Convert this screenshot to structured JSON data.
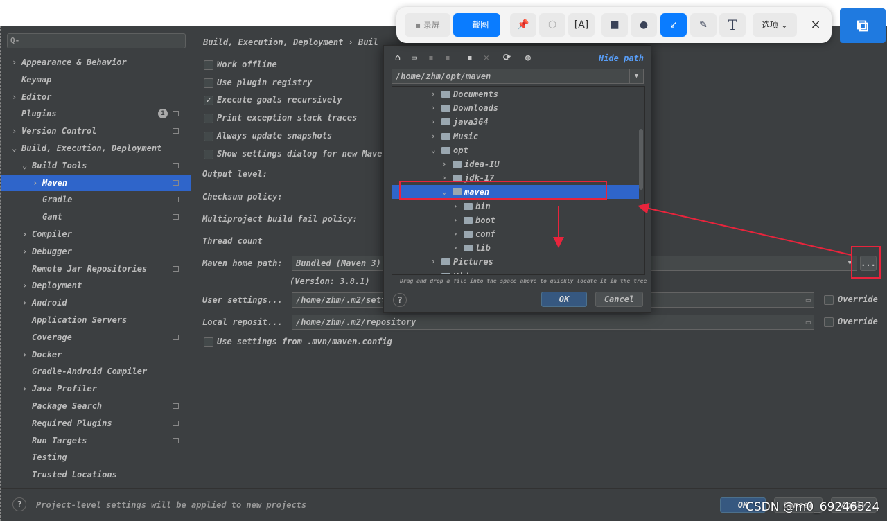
{
  "sidebar": {
    "search_placeholder": "Q-",
    "items": [
      {
        "label": "Appearance & Behavior",
        "expander": "›"
      },
      {
        "label": "Keymap"
      },
      {
        "label": "Editor",
        "expander": "›"
      },
      {
        "label": "Plugins",
        "badge": "1"
      },
      {
        "label": "Version Control",
        "expander": "›"
      },
      {
        "label": "Build, Execution, Deployment",
        "expander": "⌄"
      },
      {
        "label": "Build Tools",
        "expander": "⌄"
      },
      {
        "label": "Maven",
        "expander": "›",
        "selected": true
      },
      {
        "label": "Gradle"
      },
      {
        "label": "Gant"
      },
      {
        "label": "Compiler",
        "expander": "›"
      },
      {
        "label": "Debugger",
        "expander": "›"
      },
      {
        "label": "Remote Jar Repositories"
      },
      {
        "label": "Deployment",
        "expander": "›"
      },
      {
        "label": "Android",
        "expander": "›"
      },
      {
        "label": "Application Servers"
      },
      {
        "label": "Coverage"
      },
      {
        "label": "Docker",
        "expander": "›"
      },
      {
        "label": "Gradle-Android Compiler"
      },
      {
        "label": "Java Profiler",
        "expander": "›"
      },
      {
        "label": "Package Search"
      },
      {
        "label": "Required Plugins"
      },
      {
        "label": "Run Targets"
      },
      {
        "label": "Testing"
      },
      {
        "label": "Trusted Locations"
      }
    ]
  },
  "main": {
    "breadcrumb": "Build, Execution, Deployment › Buil",
    "checkboxes": [
      {
        "label": "Work offline",
        "checked": false
      },
      {
        "label": "Use plugin registry",
        "checked": false
      },
      {
        "label": "Execute goals recursively",
        "checked": true
      },
      {
        "label": "Print exception stack traces",
        "checked": false
      },
      {
        "label": "Always update snapshots",
        "checked": false
      },
      {
        "label": "Show settings dialog for new Mave",
        "checked": false
      }
    ],
    "output_level": "Output level:",
    "checksum_policy": "Checksum policy:",
    "fail_policy": "Multiproject build fail policy:",
    "thread_count": "Thread count",
    "maven_home_label": "Maven home path:",
    "maven_home_value": "Bundled (Maven 3)",
    "version": "(Version: 3.8.1)",
    "browse": "...",
    "user_settings_label": "User settings...",
    "user_settings_value": "/home/zhm/.m2/sett",
    "local_repo_label": "Local reposit...",
    "local_repo_value": "/home/zhm/.m2/repository",
    "override": "Override",
    "mvn_config": "Use settings from .mvn/maven.config"
  },
  "bottom": {
    "hint": "Project-level settings will be applied to new projects",
    "ok": "OK",
    "cancel": "Cancel",
    "apply": "Apply"
  },
  "dialog": {
    "hide_path": "Hide path",
    "path": "/home/zhm/opt/maven",
    "hint": "Drag and drop a file into the space above to quickly locate it in the tree",
    "ok": "OK",
    "cancel": "Cancel",
    "tree": [
      {
        "name": "Documents",
        "depth": 0,
        "open": false
      },
      {
        "name": "Downloads",
        "depth": 0,
        "open": false
      },
      {
        "name": "java364",
        "depth": 0,
        "open": false
      },
      {
        "name": "Music",
        "depth": 0,
        "open": false
      },
      {
        "name": "opt",
        "depth": 0,
        "open": true
      },
      {
        "name": "idea-IU",
        "depth": 1,
        "open": false
      },
      {
        "name": "jdk-17",
        "depth": 1,
        "open": false
      },
      {
        "name": "maven",
        "depth": 1,
        "open": true,
        "selected": true
      },
      {
        "name": "bin",
        "depth": 2,
        "open": false
      },
      {
        "name": "boot",
        "depth": 2,
        "open": false
      },
      {
        "name": "conf",
        "depth": 2,
        "open": false
      },
      {
        "name": "lib",
        "depth": 2,
        "open": false
      },
      {
        "name": "Pictures",
        "depth": 0,
        "open": false
      },
      {
        "name": "Videos",
        "depth": 0,
        "open": false
      }
    ]
  },
  "screenshot_toolbar": {
    "record": "录屏",
    "capture": "截图",
    "options": "选项",
    "close": "×"
  },
  "watermark": "CSDN @m0_69246524"
}
